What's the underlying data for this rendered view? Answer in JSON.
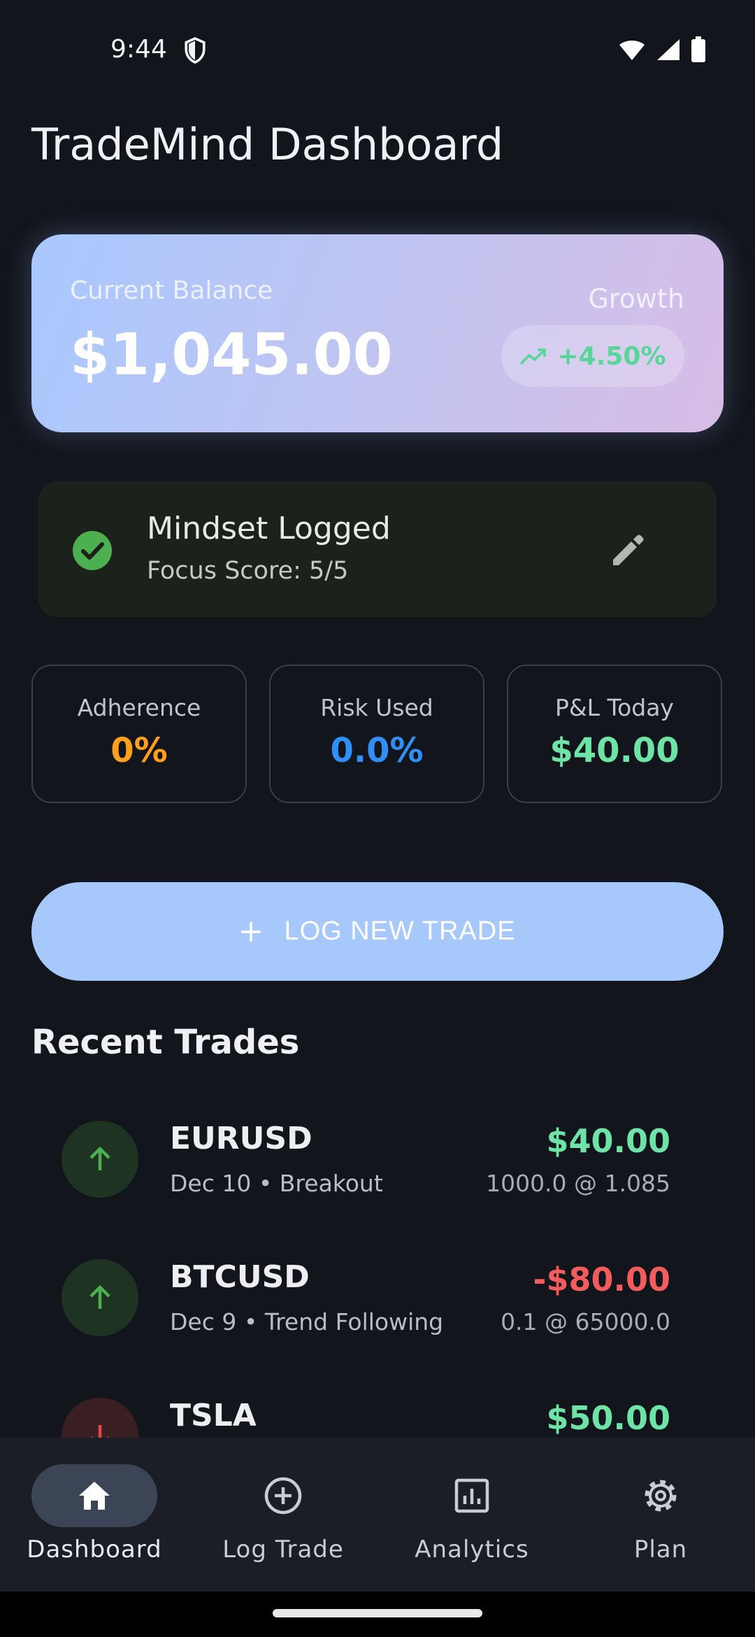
{
  "status_bar": {
    "time": "9:44"
  },
  "page": {
    "title": "TradeMind Dashboard"
  },
  "balance": {
    "label": "Current Balance",
    "value": "$1,045.00",
    "growth_label": "Growth",
    "growth_value": "+4.50%"
  },
  "mindset": {
    "title": "Mindset Logged",
    "subtitle": "Focus Score: 5/5"
  },
  "stats": [
    {
      "label": "Adherence",
      "value": "0%",
      "color": "#ff9f1a"
    },
    {
      "label": "Risk Used",
      "value": "0.0%",
      "color": "#2f8ff5"
    },
    {
      "label": "P&L Today",
      "value": "$40.00",
      "color": "#6ee3a6"
    }
  ],
  "log_button": {
    "label": "LOG NEW TRADE"
  },
  "recent": {
    "title": "Recent Trades",
    "trades": [
      {
        "symbol": "EURUSD",
        "meta": "Dec 10 • Breakout",
        "pnl": "$40.00",
        "size": "1000.0 @ 1.085",
        "direction": "up"
      },
      {
        "symbol": "BTCUSD",
        "meta": "Dec 9 • Trend Following",
        "pnl": "-$80.00",
        "size": "0.1 @ 65000.0",
        "direction": "up"
      },
      {
        "symbol": "TSLA",
        "meta": "",
        "pnl": "$50.00",
        "size": "",
        "direction": "down"
      }
    ]
  },
  "nav": [
    {
      "label": "Dashboard",
      "icon": "home-icon",
      "active": true
    },
    {
      "label": "Log Trade",
      "icon": "add-circle-icon",
      "active": false
    },
    {
      "label": "Analytics",
      "icon": "analytics-icon",
      "active": false
    },
    {
      "label": "Plan",
      "icon": "gear-icon",
      "active": false
    }
  ],
  "colors": {
    "background": "#12151b",
    "positive": "#6ee3a6",
    "negative": "#f25c5c",
    "accent": "#a6c8fb"
  }
}
